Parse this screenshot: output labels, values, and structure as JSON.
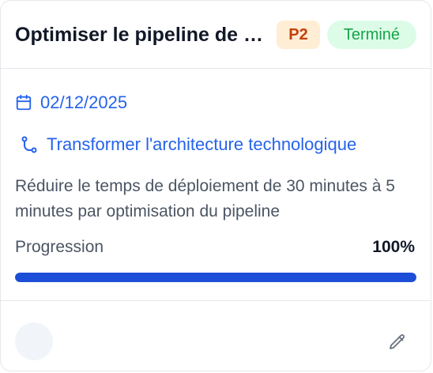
{
  "card": {
    "title": "Optimiser le pipeline de déploiement",
    "priority": "P2",
    "status": "Terminé",
    "due_date": "02/12/2025",
    "linked_objective": "Transformer l'architecture technologique",
    "description": "Réduire le temps de déploiement de 30 minutes à 5 minutes par optimisation du pipeline",
    "progress": {
      "label": "Progression",
      "value_text": "100%",
      "value": 1.0
    }
  },
  "colors": {
    "accent": "#2563eb",
    "progress_fill": "#1d4ed8",
    "priority_bg": "#ffedd5",
    "priority_text": "#c2410c",
    "status_bg": "#dcfce7",
    "status_text": "#16a34a"
  },
  "icons": {
    "date": "calendar-icon",
    "link": "git-branch-icon",
    "edit": "pencil-icon"
  }
}
